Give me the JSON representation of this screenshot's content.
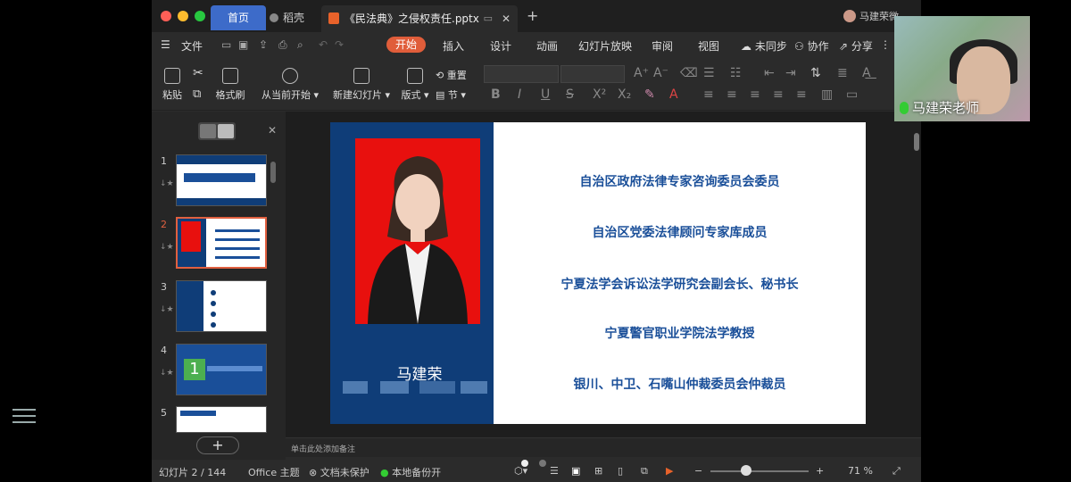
{
  "titlebar": {
    "home_tab": "首页",
    "daoke_tab": "稻壳",
    "file_tab": "《民法典》之侵权责任.pptx",
    "user": "马建荣微..."
  },
  "menubar": {
    "file": "文件",
    "items": [
      "开始",
      "插入",
      "设计",
      "动画",
      "幻灯片放映",
      "审阅",
      "视图"
    ],
    "sync": "未同步",
    "collab": "协作",
    "share": "分享"
  },
  "ribbon": {
    "paste": "粘贴",
    "format_painter": "格式刷",
    "play_from_current": "从当前开始",
    "new_slide": "新建幻灯片",
    "layout": "版式",
    "reset": "重置",
    "section": "节"
  },
  "thumbnails": {
    "numbers": [
      "1",
      "2",
      "3",
      "4",
      "5"
    ],
    "slide4_number": "1"
  },
  "slide": {
    "name": "马建荣",
    "lines": [
      "自治区政府法律专家咨询委员会委员",
      "自治区党委法律顾问专家库成员",
      "宁夏法学会诉讼法学研究会副会长、秘书长",
      "宁夏警官职业学院法学教授",
      "银川、中卫、石嘴山仲裁委员会仲裁员"
    ]
  },
  "notes_placeholder": "单击此处添加备注",
  "status": {
    "slide_count": "幻灯片 2 / 144",
    "theme": "Office 主题",
    "doc_protect": "文档未保护",
    "backup": "本地备份开",
    "zoom": "71 %"
  },
  "webcam": {
    "label": "马建荣老师"
  },
  "colors": {
    "accent": "#e05d3a",
    "home_tab": "#3d6bc9",
    "slide_blue": "#0f3d78",
    "slide_text": "#1a4f99"
  }
}
